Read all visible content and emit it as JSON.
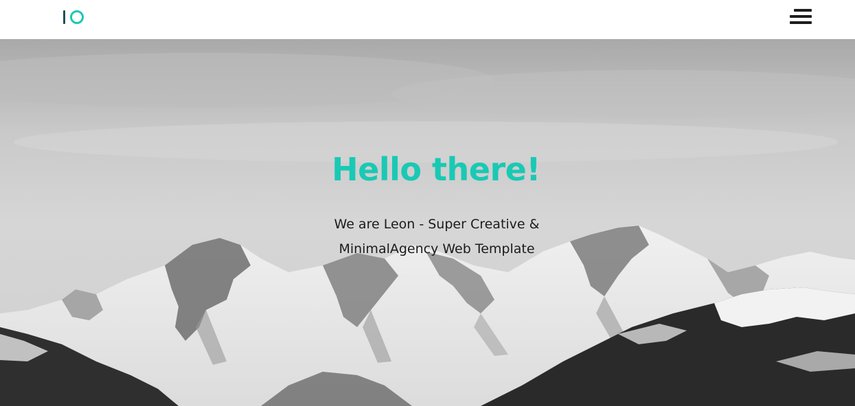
{
  "header": {
    "logo_icon": "io-logo-icon",
    "menu_icon": "hamburger-menu-icon"
  },
  "hero": {
    "title": "Hello there!",
    "subtitle": "We are Leon - Super Creative & MinimalAgency Web Template",
    "background": "snowy-mountains-photo",
    "accent_color": "#19c9b4",
    "text_color": "#1b1b1b"
  }
}
